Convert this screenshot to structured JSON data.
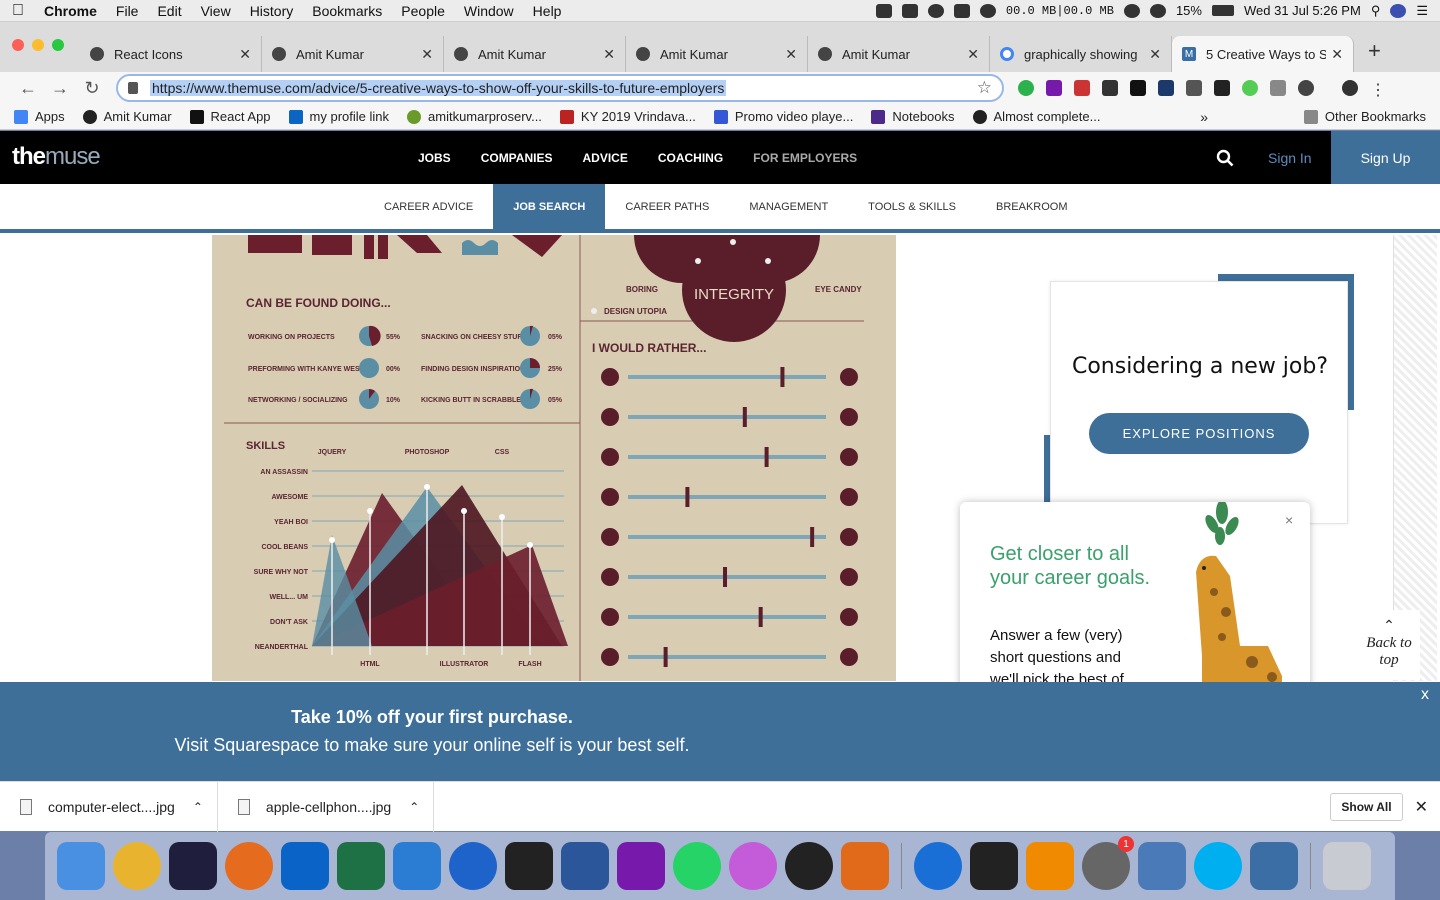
{
  "menubar": {
    "app": "Chrome",
    "items": [
      "File",
      "Edit",
      "View",
      "History",
      "Bookmarks",
      "People",
      "Window",
      "Help"
    ],
    "net": "00.0 MB|00.0 MB",
    "battery": "15%",
    "datetime": "Wed 31 Jul  5:26 PM"
  },
  "tabs": [
    {
      "label": "React Icons"
    },
    {
      "label": "Amit Kumar"
    },
    {
      "label": "Amit Kumar"
    },
    {
      "label": "Amit Kumar"
    },
    {
      "label": "Amit Kumar"
    },
    {
      "label": "graphically showing"
    },
    {
      "label": "5 Creative Ways to S",
      "favicon": "M"
    }
  ],
  "toolbar": {
    "url": "https://www.themuse.com/advice/5-creative-ways-to-show-off-your-skills-to-future-employers"
  },
  "bookmarks": {
    "items": [
      "Apps",
      "Amit Kumar",
      "React App",
      "my profile link",
      "amitkumarproserv...",
      "KY 2019 Vrindava...",
      "Promo video playe...",
      "Notebooks",
      "Almost complete..."
    ],
    "other": "Other Bookmarks"
  },
  "site": {
    "logo_a": "the",
    "logo_b": "muse",
    "nav": [
      "JOBS",
      "COMPANIES",
      "ADVICE",
      "COACHING"
    ],
    "nav_employers": "FOR EMPLOYERS",
    "signin": "Sign In",
    "signup": "Sign Up",
    "subnav": [
      "CAREER ADVICE",
      "JOB SEARCH",
      "CAREER PATHS",
      "MANAGEMENT",
      "TOOLS & SKILLS",
      "BREAKROOM"
    ]
  },
  "infographic": {
    "found_doing_title": "CAN BE FOUND DOING...",
    "activities": [
      {
        "label": "WORKING ON PROJECTS",
        "pct": "55%"
      },
      {
        "label": "PREFORMING WITH KANYE WEST",
        "pct": "00%"
      },
      {
        "label": "NETWORKING / SOCIALIZING",
        "pct": "10%"
      },
      {
        "label": "SNACKING ON CHEESY STUFF",
        "pct": "05%"
      },
      {
        "label": "FINDING DESIGN INSPIRATION",
        "pct": "25%"
      },
      {
        "label": "KICKING BUTT IN SCRABBLE",
        "pct": "05%"
      }
    ],
    "skills_title": "SKILLS",
    "skill_levels": [
      "AN ASSASSIN",
      "AWESOME",
      "YEAH BOI",
      "COOL BEANS",
      "SURE WHY NOT",
      "WELL... UM",
      "DON'T ASK",
      "NEANDERTHAL"
    ],
    "skills_top": [
      "JQUERY",
      "PHOTOSHOP",
      "CSS"
    ],
    "skills_bottom": [
      "HTML",
      "ILLUSTRATOR",
      "FLASH"
    ],
    "venn": {
      "center": "INTEGRITY",
      "left": "BORING",
      "right": "EYE CANDY",
      "bottom": "DESIGN UTOPIA"
    },
    "rather_title": "I WOULD RATHER...",
    "rather_sliders": [
      0.78,
      0.59,
      0.7,
      0.3,
      0.93,
      0.49,
      0.67,
      0.19
    ]
  },
  "sidebar": {
    "title": "Considering a new job?",
    "button": "EXPLORE POSITIONS",
    "backtop": "Back to top"
  },
  "popup": {
    "title": "Get closer to all your career goals.",
    "body": "Answer a few (very) short questions and we'll pick the best of",
    "close": "×"
  },
  "banner": {
    "line1": "Take 10% off your first purchase.",
    "line2": "Visit Squarespace to make sure your online self is your best self.",
    "close": "x"
  },
  "downloads": {
    "files": [
      "computer-elect....jpg",
      "apple-cellphon....jpg"
    ],
    "show_all": "Show All"
  },
  "dock": {
    "apps": [
      "finder-icon",
      "chrome-icon",
      "intellij-icon",
      "firefox-icon",
      "outlook-icon",
      "excel-icon",
      "vscode-icon",
      "sourcetree-icon",
      "terminal-icon",
      "word-icon",
      "onenote-icon",
      "whatsapp-icon",
      "itunes-icon",
      "power-icon",
      "butterfly-icon",
      "teamviewer-icon",
      "activity-monitor-icon",
      "vlc-icon",
      "system-preferences-icon",
      "preview-icon",
      "skype-icon",
      "migration-icon"
    ],
    "badge": "1"
  }
}
